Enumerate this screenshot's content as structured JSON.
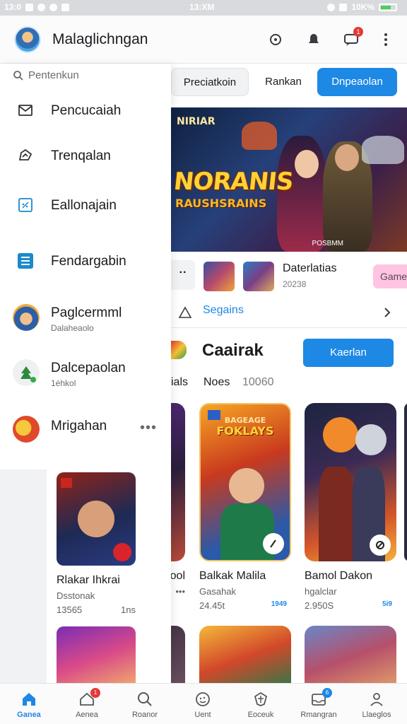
{
  "status_bar": {
    "time_left": "13:0",
    "time_center": "13:XM",
    "battery": "10K%"
  },
  "app_bar": {
    "title": "Malaglichngan",
    "notification_count": "1"
  },
  "drawer": {
    "search_placeholder": "Pentenkun",
    "items": [
      {
        "label": "Pencucaiah",
        "icon": "mail-icon"
      },
      {
        "label": "Trenqalan",
        "icon": "trending-icon"
      },
      {
        "label": "Eallonajain",
        "icon": "calendar-icon"
      },
      {
        "label": "Fendargabin",
        "icon": "list-icon"
      },
      {
        "label": "Paglcermml",
        "sub": "Dalaheaolo",
        "icon": "avatar-icon"
      },
      {
        "label": "Dalcepaolan",
        "sub": "1éhkol",
        "icon": "avatar-icon"
      },
      {
        "label": "Mrigahan",
        "icon": "avatar-icon",
        "more": "•••"
      }
    ],
    "card": {
      "name": "Rlakar Ihkrai",
      "dev": "Dsstonak",
      "installs": "13565",
      "size": "1ns"
    }
  },
  "filters": [
    "Preciatkoin",
    "Rankan",
    "Dnpeaolan"
  ],
  "banner": {
    "top": "NIRIAR",
    "title": "NORANIS",
    "subtitle": "RAUSHSRAINS",
    "caption": "POSBMM"
  },
  "promo": {
    "more": "··",
    "name": "Daterlatias",
    "sub": "20238",
    "chip": "Game"
  },
  "segments": {
    "label": "Segains"
  },
  "section": {
    "title": "Caairak",
    "button": "Kaerlan",
    "tabs": [
      "ials",
      "Noes",
      "10060"
    ]
  },
  "cards": [
    {
      "name": "ool",
      "dev": "",
      "installs": "•••",
      "tag": ""
    },
    {
      "name": "Balkak Malila",
      "dev": "Gasahak",
      "installs": "24.45t",
      "tag": "1949",
      "art_title": "FOKLAYS",
      "art_top": "BAGEAGE"
    },
    {
      "name": "Bamol Dakon",
      "dev": "hgalclar",
      "installs": "2.950S",
      "tag": "5i9"
    }
  ],
  "bottom_nav": [
    {
      "label": "Ganea",
      "icon": "home-icon",
      "active": true
    },
    {
      "label": "Aenea",
      "icon": "apps-icon",
      "badge": "1"
    },
    {
      "label": "Roanor",
      "icon": "search-icon"
    },
    {
      "label": "Uent",
      "icon": "compass-icon"
    },
    {
      "label": "Eoceuk",
      "icon": "shield-icon"
    },
    {
      "label": "Rmangran",
      "icon": "inbox-icon",
      "badge": "6"
    },
    {
      "label": "Llaeglos",
      "icon": "person-icon"
    }
  ]
}
